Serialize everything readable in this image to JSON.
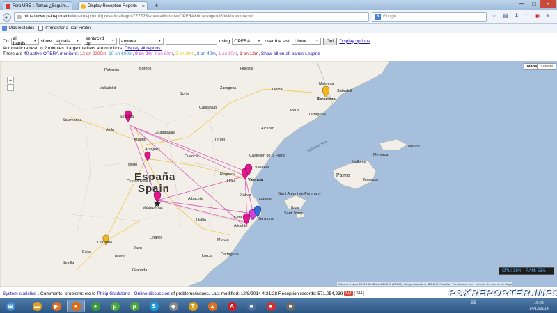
{
  "browser": {
    "tabs": [
      {
        "title": "Foro URE :: Temas ¿Seguim...",
        "close": "×"
      },
      {
        "title": "Display Reception Reports",
        "close": "×"
      }
    ],
    "new_tab": "+",
    "url_host": "https://www.pskreporter.info",
    "url_path": "/pskmap.html?preset&callsign=ZZZZZ&what=all&mode=OPERA&timerange=3600&hideunrec=1",
    "search_placeholder": "Google",
    "search_engine_letter": "8",
    "window_controls": [
      "—",
      "□",
      "×"
    ],
    "bookmarks": [
      {
        "label": "Más visitados"
      },
      {
        "label": "Comenzar a usar Firefox"
      }
    ]
  },
  "controls": {
    "on_label": "On",
    "band_value": "all bands",
    "show_label": "show",
    "show_value": "signals",
    "sent_value": "sent/rcvd by",
    "who_value": "anyone",
    "using_label": "using",
    "mode_value": "OPERA",
    "over_label": "over the last",
    "time_value": "1 hour",
    "go_label": "Go!",
    "options_link": "Display options",
    "refresh_text": "Automatic refresh in 2 minutes. Large markers are monitors.",
    "all_reports_link": "Display all reports.",
    "there_are": "There are",
    "monitors_link": "40 active OPERA monitors",
    "bands": [
      {
        "label": "12 on 2200m",
        "color": "#d43030"
      },
      {
        "label": "10 on 600m",
        "color": "#2f8fd8"
      },
      {
        "label": "9 on 2m",
        "color": "#cc00cc"
      },
      {
        "label": "3 on 80m",
        "color": "#e060e0"
      },
      {
        "label": "2 on 20m",
        "color": "#e6b800"
      },
      {
        "label": "2 on 40m",
        "color": "#1a5fd6"
      },
      {
        "label": "1 on 10m",
        "color": "#ff5fb0"
      },
      {
        "label": "1 on 12m",
        "color": "#cc0000"
      }
    ],
    "show_all_link": "Show all on all bands",
    "legend_link": "Legend"
  },
  "map": {
    "type_map": "Mapa",
    "type_sat": "Satélite",
    "country_es": "España",
    "country_en": "Spain",
    "labels": [
      "Valladolid",
      "Segovia",
      "Madrid",
      "Toledo",
      "Cuenca",
      "Zaragoza",
      "Lleida",
      "Barcelona",
      "Reus",
      "Castellón de la Plana",
      "Valencia",
      "Albacete",
      "Ciudad Real",
      "Córdoba",
      "Sevilla",
      "Murcia",
      "Alicante",
      "Cartagena",
      "Palma",
      "Ibiza",
      "Menorca",
      "Sant Antoni de Portmany",
      "Aranjuez",
      "Guadalajara",
      "Teruel",
      "Granada",
      "Jaén",
      "Lorca",
      "Vila-real",
      "Tarragona",
      "Manresa",
      "Sabadell",
      "Huesca",
      "Soria",
      "Burgos",
      "Palencia",
      "Calatayud",
      "Benidorm",
      "Elda",
      "Hellín",
      "Valdepeñas",
      "Linares",
      "Lucena",
      "Écija",
      "Ávila",
      "Salamanca",
      "Alcañiz",
      "Gandia",
      "Xàtiva",
      "Requena",
      "Mahón",
      "Mallorca",
      "Balearic Sea",
      "Manacor",
      "Sant Josep",
      "Utiel"
    ],
    "sea_label": "Balearic Sea",
    "attribution": "Datos de mapas ©2014 GeoBasis-DE/BKG (©2009), Google, basado en BCN IGN España · Términos de uso · Informar de un error de Maps",
    "cpu_text": "CPU: 38%",
    "ram_text": "RAM: 56%"
  },
  "footer": {
    "stats_link": "System statistics",
    "text1": ". Comments, problems etc to",
    "gladstone_link": "Philip Gladstone",
    "dot": ".",
    "discussion_link": "Online discussion",
    "text2": "of problems/issues. Last modified: 12/8/2014 4:21:28 Reception records: 571,054,239",
    "gplus": "8+1",
    "count": "344",
    "brand": "PSKREPORTER.INFO"
  },
  "taskbar": {
    "items": [
      {
        "icon": "windows-start-icon",
        "color": "#3b8ed0",
        "glyph": "⊞"
      },
      {
        "icon": "explorer-icon",
        "color": "#e0a020",
        "glyph": "▬"
      },
      {
        "icon": "media-player-icon",
        "color": "#e07020",
        "glyph": "▶"
      },
      {
        "icon": "firefox-icon",
        "color": "#e06a10",
        "glyph": "●"
      },
      {
        "icon": "chrome-icon",
        "color": "#3a9a3a",
        "glyph": "●"
      },
      {
        "icon": "torrent-icon",
        "color": "#4aa83a",
        "glyph": "μ"
      },
      {
        "icon": "torrent2-icon",
        "color": "#4aa83a",
        "glyph": "μ"
      },
      {
        "icon": "skype-icon",
        "color": "#1d9ad8",
        "glyph": "S"
      },
      {
        "icon": "app-icon",
        "color": "#888888",
        "glyph": "◆"
      },
      {
        "icon": "app2-icon",
        "color": "#d6a020",
        "glyph": "T"
      },
      {
        "icon": "app3-icon",
        "color": "#e07020",
        "glyph": "▲"
      },
      {
        "icon": "acrobat-icon",
        "color": "#c8202a",
        "glyph": "A"
      },
      {
        "icon": "app4-icon",
        "color": "#4a6fa5",
        "glyph": "■"
      },
      {
        "icon": "app5-icon",
        "color": "#d03030",
        "glyph": "■"
      },
      {
        "icon": "app6-icon",
        "color": "#6a6a6a",
        "glyph": "■"
      }
    ],
    "lang": "ES",
    "time": "16:06",
    "date": "14/12/2014"
  }
}
